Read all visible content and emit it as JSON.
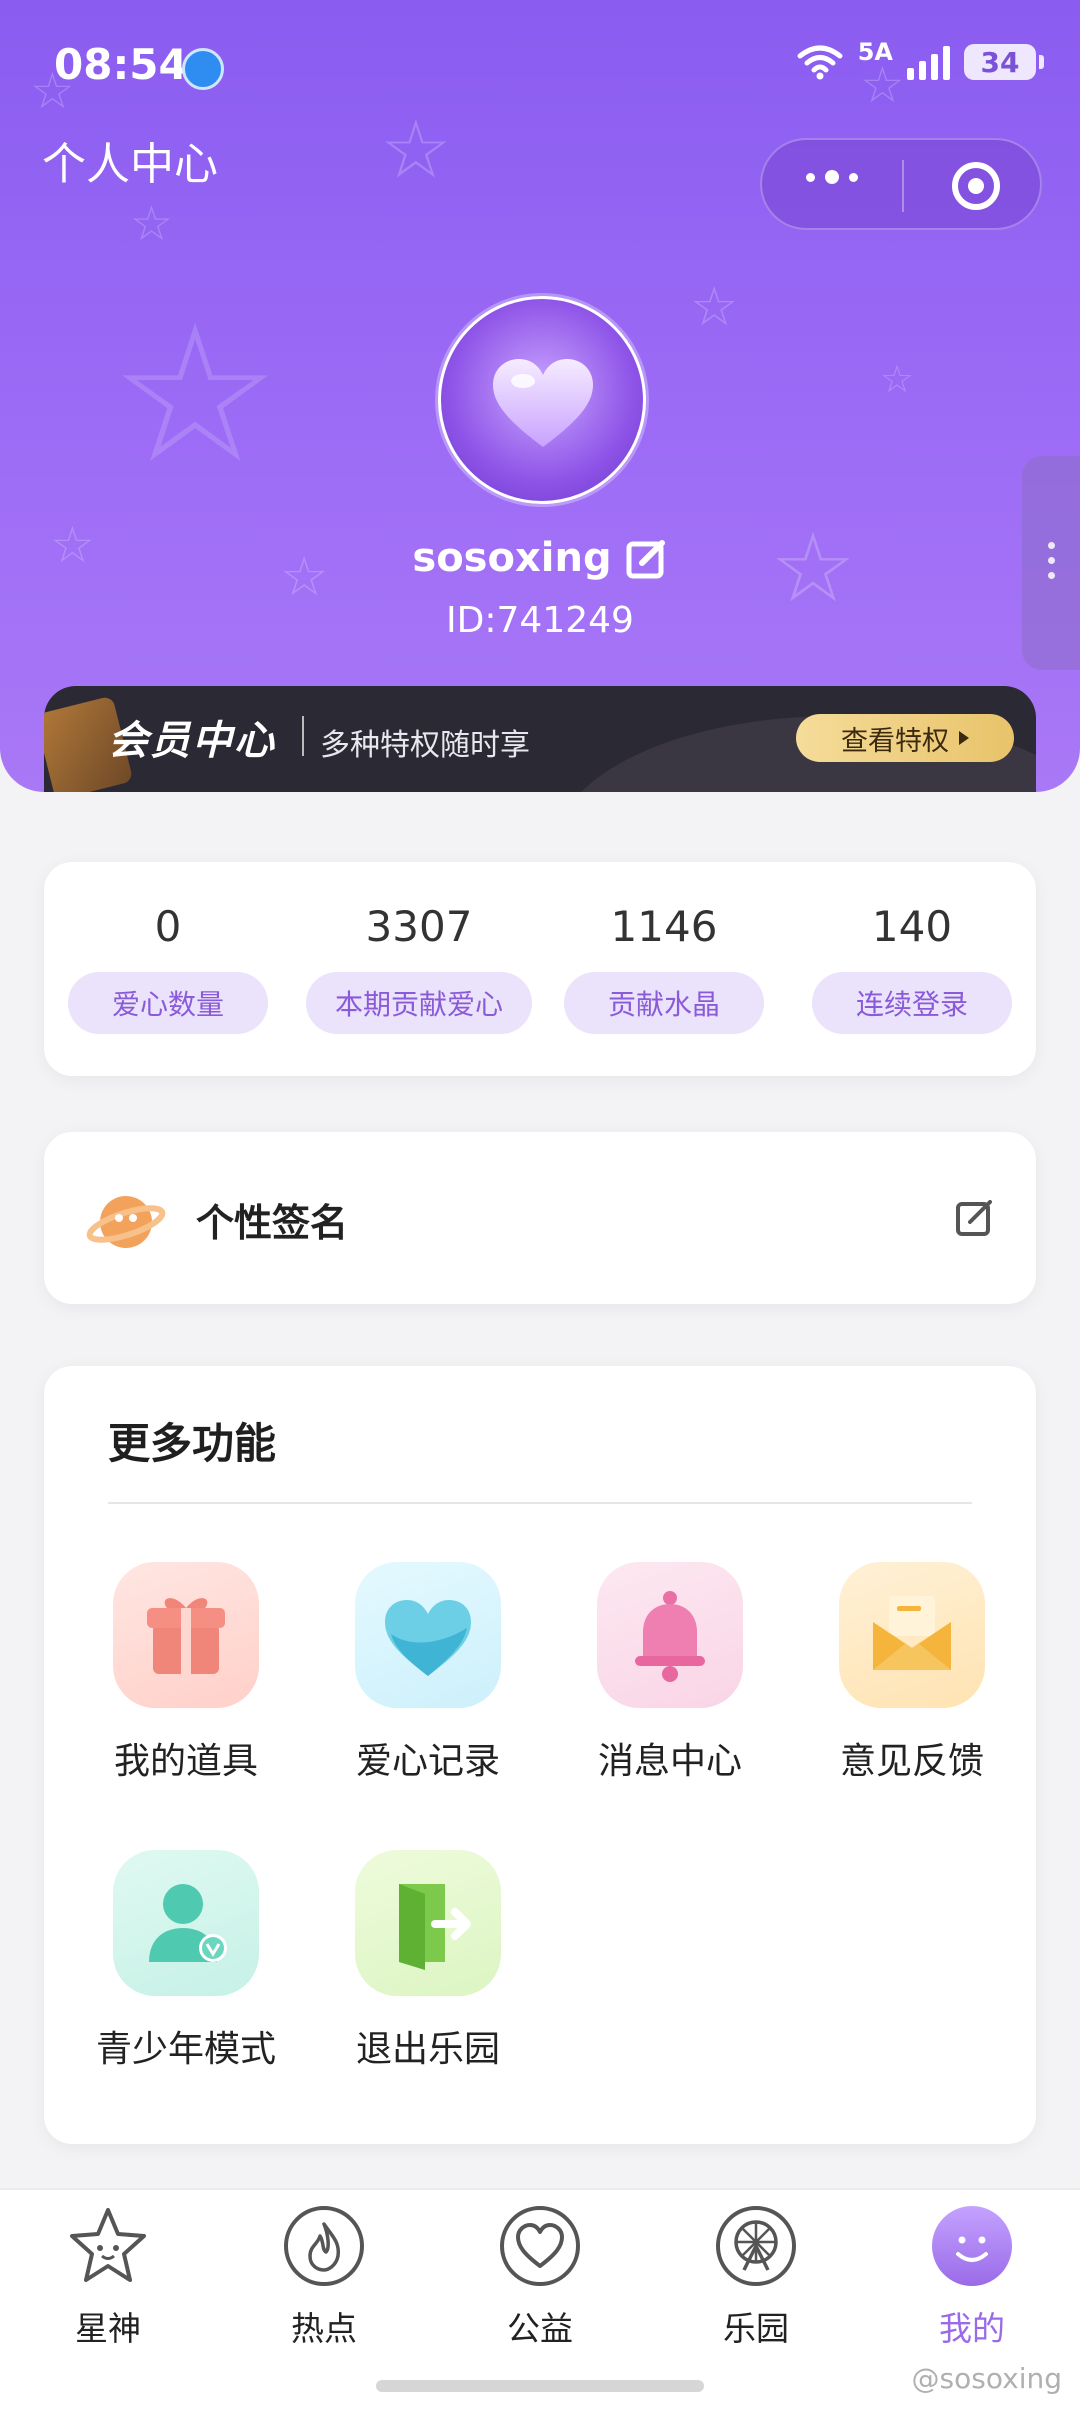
{
  "status_bar": {
    "time": "08:54",
    "network_label": "5A",
    "battery": "34"
  },
  "header": {
    "title": "个人中心",
    "username": "sosoxing",
    "user_id": "ID:741249"
  },
  "vip_banner": {
    "title": "会员中心",
    "subtitle": "多种特权随时享",
    "button": "查看特权"
  },
  "stats": [
    {
      "value": "0",
      "label": "爱心数量"
    },
    {
      "value": "3307",
      "label": "本期贡献爱心"
    },
    {
      "value": "1146",
      "label": "贡献水晶"
    },
    {
      "value": "140",
      "label": "连续登录"
    }
  ],
  "signature": {
    "label": "个性签名"
  },
  "more_functions": {
    "title": "更多功能",
    "items": [
      {
        "label": "我的道具",
        "icon": "gift-icon"
      },
      {
        "label": "爱心记录",
        "icon": "heart-record-icon"
      },
      {
        "label": "消息中心",
        "icon": "bell-icon"
      },
      {
        "label": "意见反馈",
        "icon": "envelope-icon"
      },
      {
        "label": "青少年模式",
        "icon": "teen-user-icon"
      },
      {
        "label": "退出乐园",
        "icon": "exit-door-icon"
      }
    ]
  },
  "bottom_nav": {
    "items": [
      {
        "label": "星神",
        "icon": "star-face-icon"
      },
      {
        "label": "热点",
        "icon": "flame-icon"
      },
      {
        "label": "公益",
        "icon": "heart-outline-icon"
      },
      {
        "label": "乐园",
        "icon": "ferris-wheel-icon"
      },
      {
        "label": "我的",
        "icon": "smiley-icon",
        "active": true
      }
    ]
  },
  "watermark": "@sosoxing",
  "colors": {
    "header_purple": "#9466f3",
    "accent_purple": "#9a6be8",
    "pill_bg": "#ebe2fb",
    "vip_gold": "#e8c36a"
  }
}
